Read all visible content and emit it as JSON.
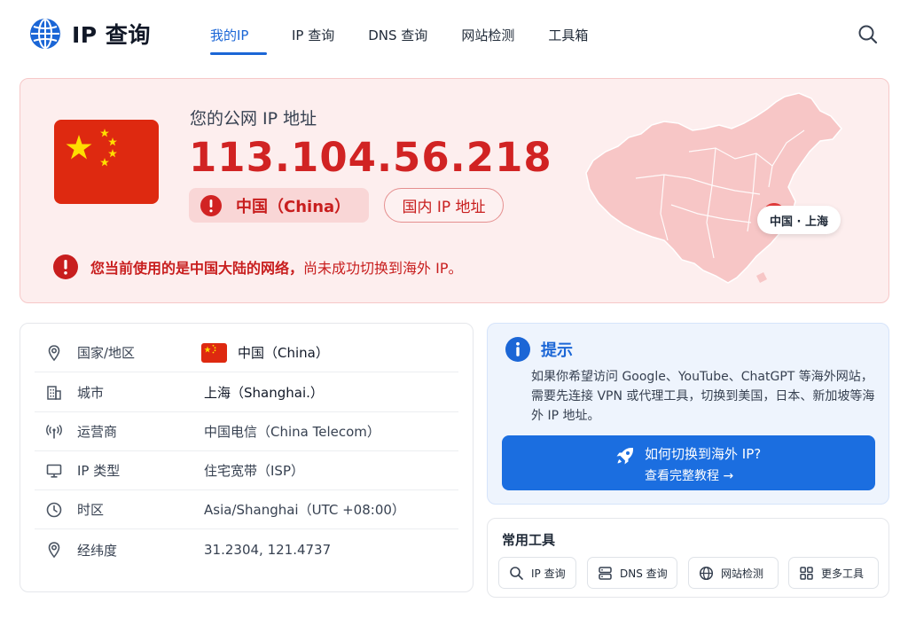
{
  "header": {
    "title": "IP 查询",
    "nav": [
      {
        "label": "我的IP",
        "active": true
      },
      {
        "label": "IP 查询",
        "active": false
      },
      {
        "label": "DNS 查询",
        "active": false
      },
      {
        "label": "网站检测",
        "active": false
      },
      {
        "label": "工具箱",
        "active": false
      }
    ]
  },
  "hero": {
    "label": "您的公网 IP 地址",
    "ip": "113.104.56.218",
    "country": "中国（China）",
    "tag": "国内 IP 地址",
    "warning_bold": "您当前使用的是中国大陆的网络，",
    "warning_rest": "尚未成功切换到海外 IP。",
    "map_location": "中国 · 上海"
  },
  "info": [
    {
      "label": "国家/地区",
      "value": "中国（China）"
    },
    {
      "label": "城市",
      "value": "上海（Shanghai.）"
    },
    {
      "label": "运营商",
      "value": "中国电信（China Telecom）"
    },
    {
      "label": "IP 类型",
      "value": "住宅宽带（ISP）"
    },
    {
      "label": "时区",
      "value": "Asia/Shanghai（UTC +08:00）"
    },
    {
      "label": "经纬度",
      "value": "31.2304, 121.4737"
    }
  ],
  "tip": {
    "title": "提示",
    "body": "如果你希望访问 Google、YouTube、ChatGPT 等海外网站，需要先连接 VPN 或代理工具，切换到美国，日本、新加坡等海外 IP 地址。",
    "button_line1": "如何切换到海外 IP?",
    "button_line2": "查看完整教程 →"
  },
  "tools": {
    "title": "常用工具",
    "items": [
      {
        "label": "IP 查询",
        "icon": "search-icon"
      },
      {
        "label": "DNS 查询",
        "icon": "server-icon"
      },
      {
        "label": "网站检测",
        "icon": "globe-icon"
      },
      {
        "label": "更多工具",
        "icon": "grid-icon"
      }
    ]
  },
  "colors": {
    "accent": "#1b66d6",
    "alert": "#c81e1e",
    "hero_bg": "#fdeeee",
    "flag_red": "#de2910",
    "flag_yellow": "#ffde00"
  }
}
